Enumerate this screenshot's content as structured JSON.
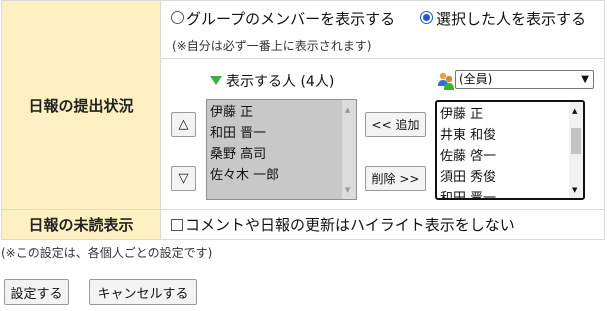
{
  "rows": {
    "report_status_label": "日報の提出状況",
    "unread_label": "日報の未読表示"
  },
  "display_mode": {
    "group_label": "グループのメンバーを表示する",
    "selected_label": "選択した人を表示する",
    "selected_value": "selected",
    "note": "(※自分は必ず一番上に表示されます)"
  },
  "shown_list": {
    "heading": "表示する人 (4人)",
    "people": [
      "伊藤 正",
      "和田 晋一",
      "桑野 高司",
      "佐々木 一郎"
    ]
  },
  "buttons": {
    "move_up": "△",
    "move_down": "▽",
    "add": "<< 追加",
    "remove": "削除 >>",
    "save": "設定する",
    "cancel": "キャンセルする"
  },
  "group_select": {
    "value": "(全員)",
    "options": [
      "伊藤 正",
      "井東 和俊",
      "佐藤 啓一",
      "須田 秀俊",
      "和田 晋一"
    ]
  },
  "unread_option": {
    "label": "コメントや日報の更新はハイライト表示をしない",
    "checked": false
  },
  "footer_note": "(※この設定は、各個人ごとの設定です)",
  "colors": {
    "label_bg": "#fdf0c3",
    "list_selected_bg": "#c8c8c8",
    "triangle_green": "#3cb043",
    "radio_blue": "#1a5bd8"
  }
}
